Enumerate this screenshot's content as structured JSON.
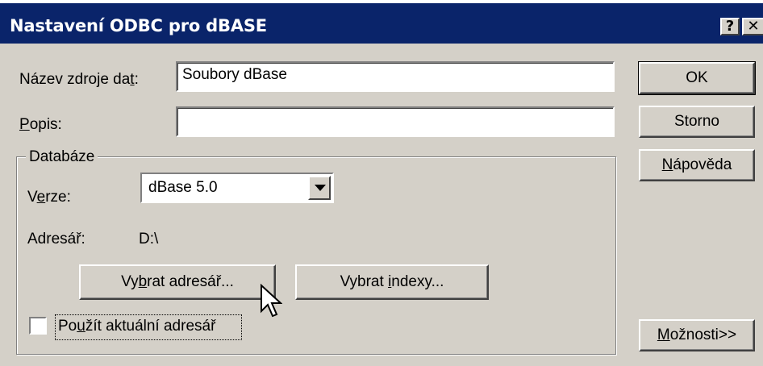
{
  "window": {
    "title": "Nastavení ODBC pro dBASE",
    "help_btn": "?",
    "close_btn": "✕"
  },
  "fields": {
    "data_source_label": "Název zdroje dat:",
    "data_source_value": "Soubory dBase",
    "description_label": "Popis:",
    "description_value": ""
  },
  "database": {
    "group_label": "Databáze",
    "version_label": "Verze:",
    "version_value": "dBase 5.0",
    "directory_label": "Adresář:",
    "directory_value": "D:\\",
    "select_dir_button": "Vybrat adresář...",
    "select_index_button": "Vybrat indexy...",
    "use_current_dir_label": "Použít aktuální adresář",
    "use_current_dir_checked": false
  },
  "buttons": {
    "ok": "OK",
    "cancel": "Storno",
    "help": "Nápověda",
    "options": "Možnosti>>"
  },
  "colors": {
    "titlebar": "#0a246a",
    "face": "#d4d0c8"
  }
}
